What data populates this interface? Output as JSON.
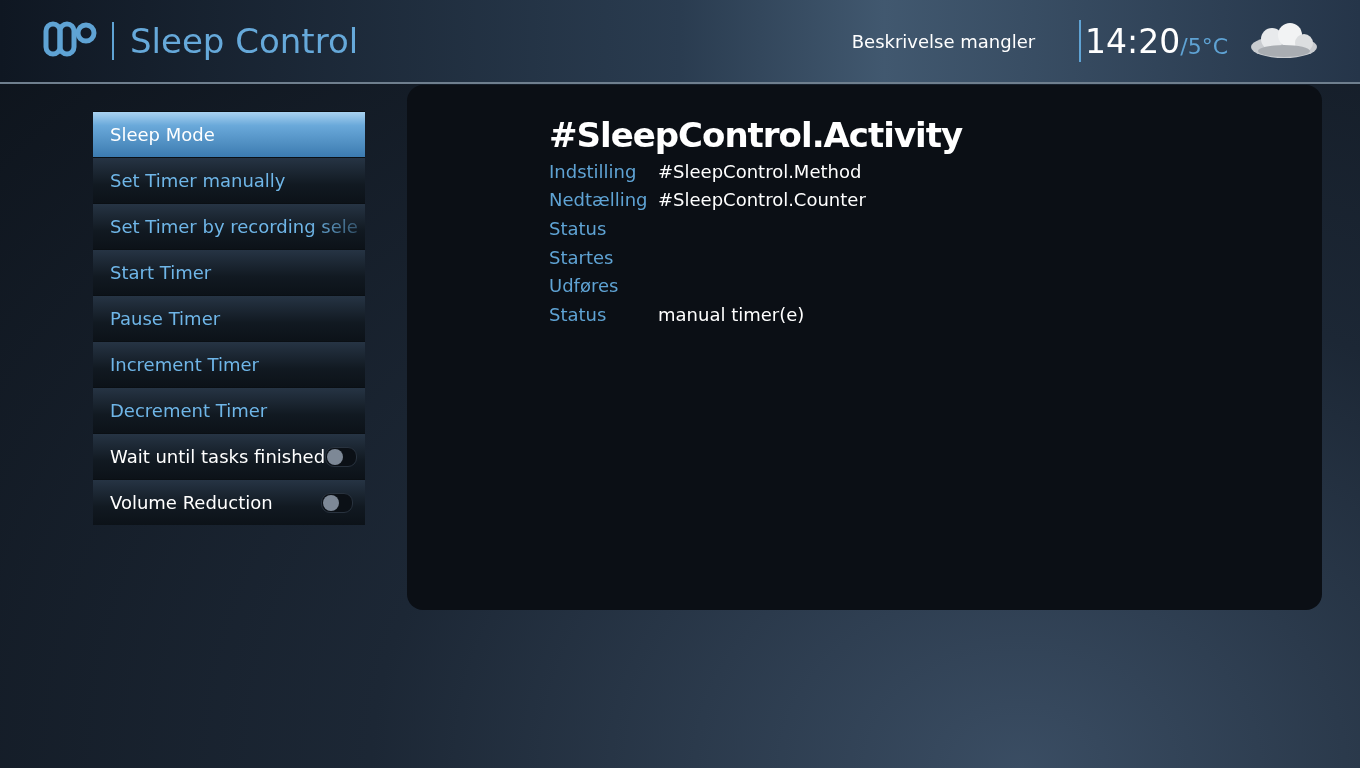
{
  "header": {
    "title": "Sleep Control",
    "description": "Beskrivelse mangler",
    "time": "14:20",
    "temperature": "/5°C"
  },
  "menu": [
    {
      "kind": "action",
      "label": "Sleep Mode",
      "selected": true
    },
    {
      "kind": "action",
      "label": "Set Timer manually",
      "selected": false
    },
    {
      "kind": "action",
      "label": "Set Timer by recording sele",
      "selected": false
    },
    {
      "kind": "action",
      "label": "Start Timer",
      "selected": false
    },
    {
      "kind": "action",
      "label": "Pause Timer",
      "selected": false
    },
    {
      "kind": "action",
      "label": "Increment Timer",
      "selected": false
    },
    {
      "kind": "action",
      "label": "Decrement Timer",
      "selected": false
    },
    {
      "kind": "toggle",
      "label": "Wait until tasks finished",
      "selected": false,
      "on": false
    },
    {
      "kind": "toggle",
      "label": "Volume Reduction",
      "selected": false,
      "on": false
    }
  ],
  "details": {
    "heading": "#SleepControl.Activity",
    "rows": [
      {
        "label": "Indstilling",
        "value": "#SleepControl.Method"
      },
      {
        "label": "Nedtælling",
        "value": "#SleepControl.Counter"
      },
      {
        "label": "Status"
      },
      {
        "label": "Startes"
      },
      {
        "label": "Udføres"
      },
      {
        "label": "Status",
        "value": "manual timer(e)"
      }
    ]
  }
}
